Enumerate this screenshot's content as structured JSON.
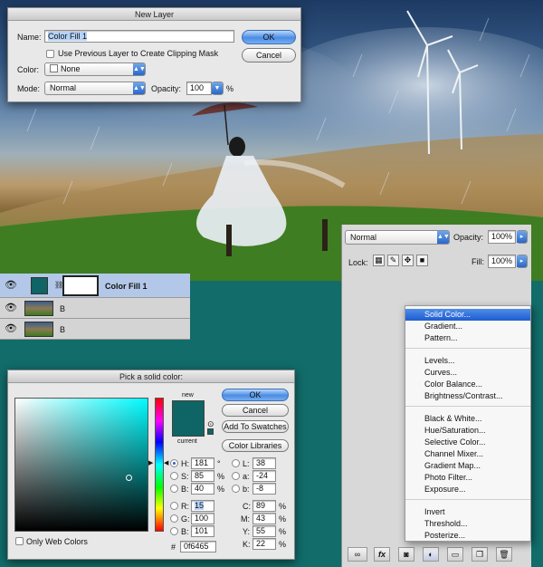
{
  "colors": {
    "teal_bg": "#116c6a",
    "picked_color": "#0f6465",
    "accent": "#2a68c9"
  },
  "new_layer": {
    "title": "New Layer",
    "name_label": "Name:",
    "name_value": "Color Fill 1",
    "clipping_label": "Use Previous Layer to Create Clipping Mask",
    "color_label": "Color:",
    "color_value": "None",
    "mode_label": "Mode:",
    "mode_value": "Normal",
    "opacity_label": "Opacity:",
    "opacity_value": "100",
    "opacity_unit": "%",
    "ok": "OK",
    "cancel": "Cancel"
  },
  "layers": {
    "blend_mode": "Normal",
    "opacity_label": "Opacity:",
    "opacity_value": "100%",
    "lock_label": "Lock:",
    "fill_label": "Fill:",
    "fill_value": "100%",
    "rows": [
      {
        "name": "Color Fill 1"
      },
      {
        "name": "B"
      },
      {
        "name": "B"
      }
    ]
  },
  "adjust_menu": {
    "group1": [
      "Solid Color...",
      "Gradient...",
      "Pattern..."
    ],
    "group2": [
      "Levels...",
      "Curves...",
      "Color Balance...",
      "Brightness/Contrast..."
    ],
    "group3": [
      "Black & White...",
      "Hue/Saturation...",
      "Selective Color...",
      "Channel Mixer...",
      "Gradient Map...",
      "Photo Filter...",
      "Exposure..."
    ],
    "group4": [
      "Invert",
      "Threshold...",
      "Posterize..."
    ]
  },
  "picker": {
    "title": "Pick a solid color:",
    "new_label": "new",
    "current_label": "current",
    "ok": "OK",
    "cancel": "Cancel",
    "add_swatches": "Add To Swatches",
    "color_libraries": "Color Libraries",
    "only_web": "Only Web Colors",
    "h_label": "H:",
    "h_value": "181",
    "h_unit": "°",
    "s_label": "S:",
    "s_value": "85",
    "s_unit": "%",
    "b_label": "B:",
    "b_value": "40",
    "b_unit": "%",
    "r_label": "R:",
    "r_value": "15",
    "g_label": "G:",
    "g_value": "100",
    "bl_label": "B:",
    "bl_value": "101",
    "l_label": "L:",
    "l_value": "38",
    "a_label": "a:",
    "a_value": "-24",
    "lb_label": "b:",
    "lb_value": "-8",
    "c_label": "C:",
    "c_value": "89",
    "m_label": "M:",
    "m_value": "43",
    "y_label": "Y:",
    "y_value": "55",
    "k_label": "K:",
    "k_value": "22",
    "pct": "%",
    "hex_label": "#",
    "hex_value": "0f6465"
  }
}
